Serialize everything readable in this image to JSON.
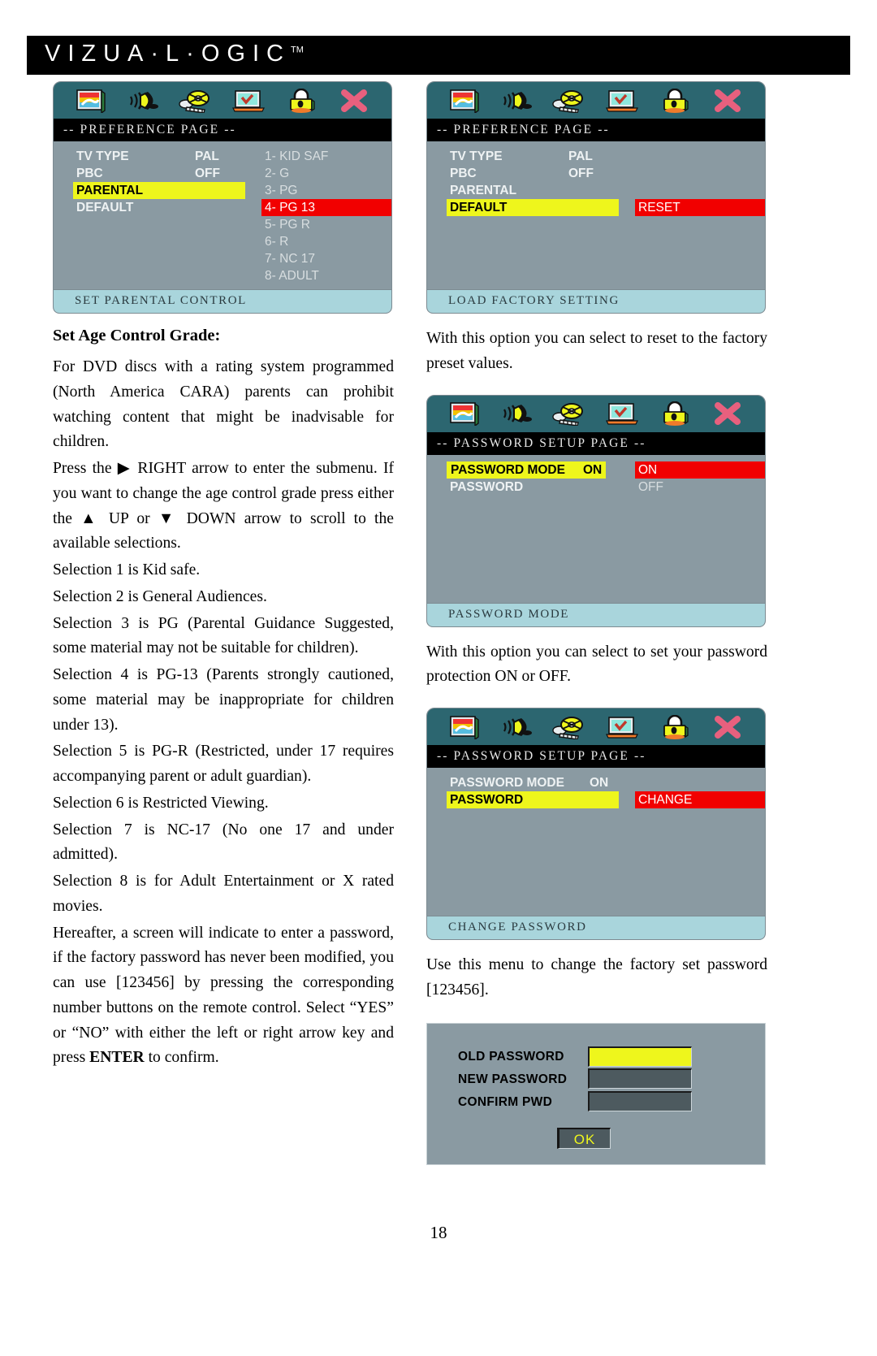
{
  "brand": {
    "name": "VIZUA·L·OGIC",
    "trademark": "TM"
  },
  "page_number": "18",
  "osd_icons": [
    "picture-tv-icon",
    "speaker-audio-icon",
    "film-reel-icon",
    "preference-laptop-check-icon",
    "lock-password-icon",
    "exit-x-icon"
  ],
  "panels": {
    "parental": {
      "title": "-- PREFERENCE PAGE --",
      "caption": "SET PARENTAL CONTROL",
      "rows": [
        {
          "label": "TV TYPE",
          "value": "PAL",
          "highlighted": false
        },
        {
          "label": "PBC",
          "value": "OFF",
          "highlighted": false
        },
        {
          "label": "PARENTAL",
          "value": "",
          "highlighted": true
        },
        {
          "label": "DEFAULT",
          "value": "",
          "highlighted": false
        }
      ],
      "options": [
        {
          "label": "1- KID SAF",
          "selected": false
        },
        {
          "label": "2- G",
          "selected": false
        },
        {
          "label": "3- PG",
          "selected": false
        },
        {
          "label": "4- PG 13",
          "selected": true
        },
        {
          "label": "5- PG R",
          "selected": false
        },
        {
          "label": "6- R",
          "selected": false
        },
        {
          "label": "7- NC 17",
          "selected": false
        },
        {
          "label": "8- ADULT",
          "selected": false
        }
      ]
    },
    "default": {
      "title": "-- PREFERENCE PAGE --",
      "caption": "LOAD FACTORY SETTING",
      "rows": [
        {
          "label": "TV TYPE",
          "value": "PAL",
          "highlighted": false
        },
        {
          "label": "PBC",
          "value": "OFF",
          "highlighted": false
        },
        {
          "label": "PARENTAL",
          "value": "",
          "highlighted": false
        },
        {
          "label": "DEFAULT",
          "value": "",
          "highlighted": true
        }
      ],
      "options": [
        {
          "label": "RESET",
          "selected": true
        }
      ]
    },
    "password_mode": {
      "title": "-- PASSWORD SETUP PAGE --",
      "caption": "PASSWORD MODE",
      "row_highlight_label": "PASSWORD MODE",
      "row_highlight_value": "ON",
      "row_second_label": "PASSWORD",
      "options": [
        {
          "label": "ON",
          "selected": true
        },
        {
          "label": "OFF",
          "selected": false
        }
      ]
    },
    "change_password": {
      "title": "-- PASSWORD SETUP PAGE --",
      "caption": "CHANGE PASSWORD",
      "row_first_label": "PASSWORD MODE",
      "row_first_value": "ON",
      "row_highlight_label": "PASSWORD",
      "options": [
        {
          "label": "CHANGE",
          "selected": true
        }
      ]
    }
  },
  "password_dialog": {
    "fields": [
      {
        "label": "OLD PASSWORD",
        "state": "active"
      },
      {
        "label": "NEW PASSWORD",
        "state": "empty"
      },
      {
        "label": "CONFIRM PWD",
        "state": "empty"
      }
    ],
    "ok_label": "OK"
  },
  "left_column": {
    "heading": "Set Age Control Grade:",
    "paragraphs": [
      "For DVD discs with a rating system programmed (North America CARA) parents can prohibit watching content that might be inadvisable for children.",
      "Press the ▶ RIGHT arrow to enter the submenu.  If you want to change the age control grade press either the ▲ UP or ▼ DOWN arrow to scroll to the available selections.",
      "Selection 1 is Kid safe.",
      "Selection 2 is General Audiences.",
      "Selection 3 is PG (Parental Guidance Suggested, some material may not be suitable for children).",
      "Selection 4 is PG-13 (Parents strongly cautioned, some material may be inappropriate for children under 13).",
      "Selection 5 is PG-R (Restricted, under 17 requires accompanying parent or adult guardian).",
      "Selection 6 is Restricted Viewing.",
      "Selection 7 is NC-17 (No one 17 and under admitted).",
      "Selection 8 is for Adult Entertainment or X rated movies.",
      "Hereafter, a screen will indicate to enter a password, if the factory password has never been modified, you can use [123456] by pressing the corresponding number buttons on the remote control.  Select “YES” or “NO” with either the left or right arrow key and press ENTER to confirm."
    ],
    "last_paragraph_pre": "Hereafter, a screen will indicate to enter a password, if the factory password has never been modified, you can use [123456] by pressing the corresponding number buttons on the remote control.  Select “YES” or “NO” with either the left or right arrow key and press ",
    "last_paragraph_bold": "ENTER",
    "last_paragraph_post": " to confirm."
  },
  "right_column": {
    "paragraph_default": "With this option you can select to reset to the factory preset values.",
    "paragraph_password_mode": "With this option you can select to set your password protection ON or OFF.",
    "paragraph_change_password": "Use this menu to change the factory set password [123456]."
  }
}
